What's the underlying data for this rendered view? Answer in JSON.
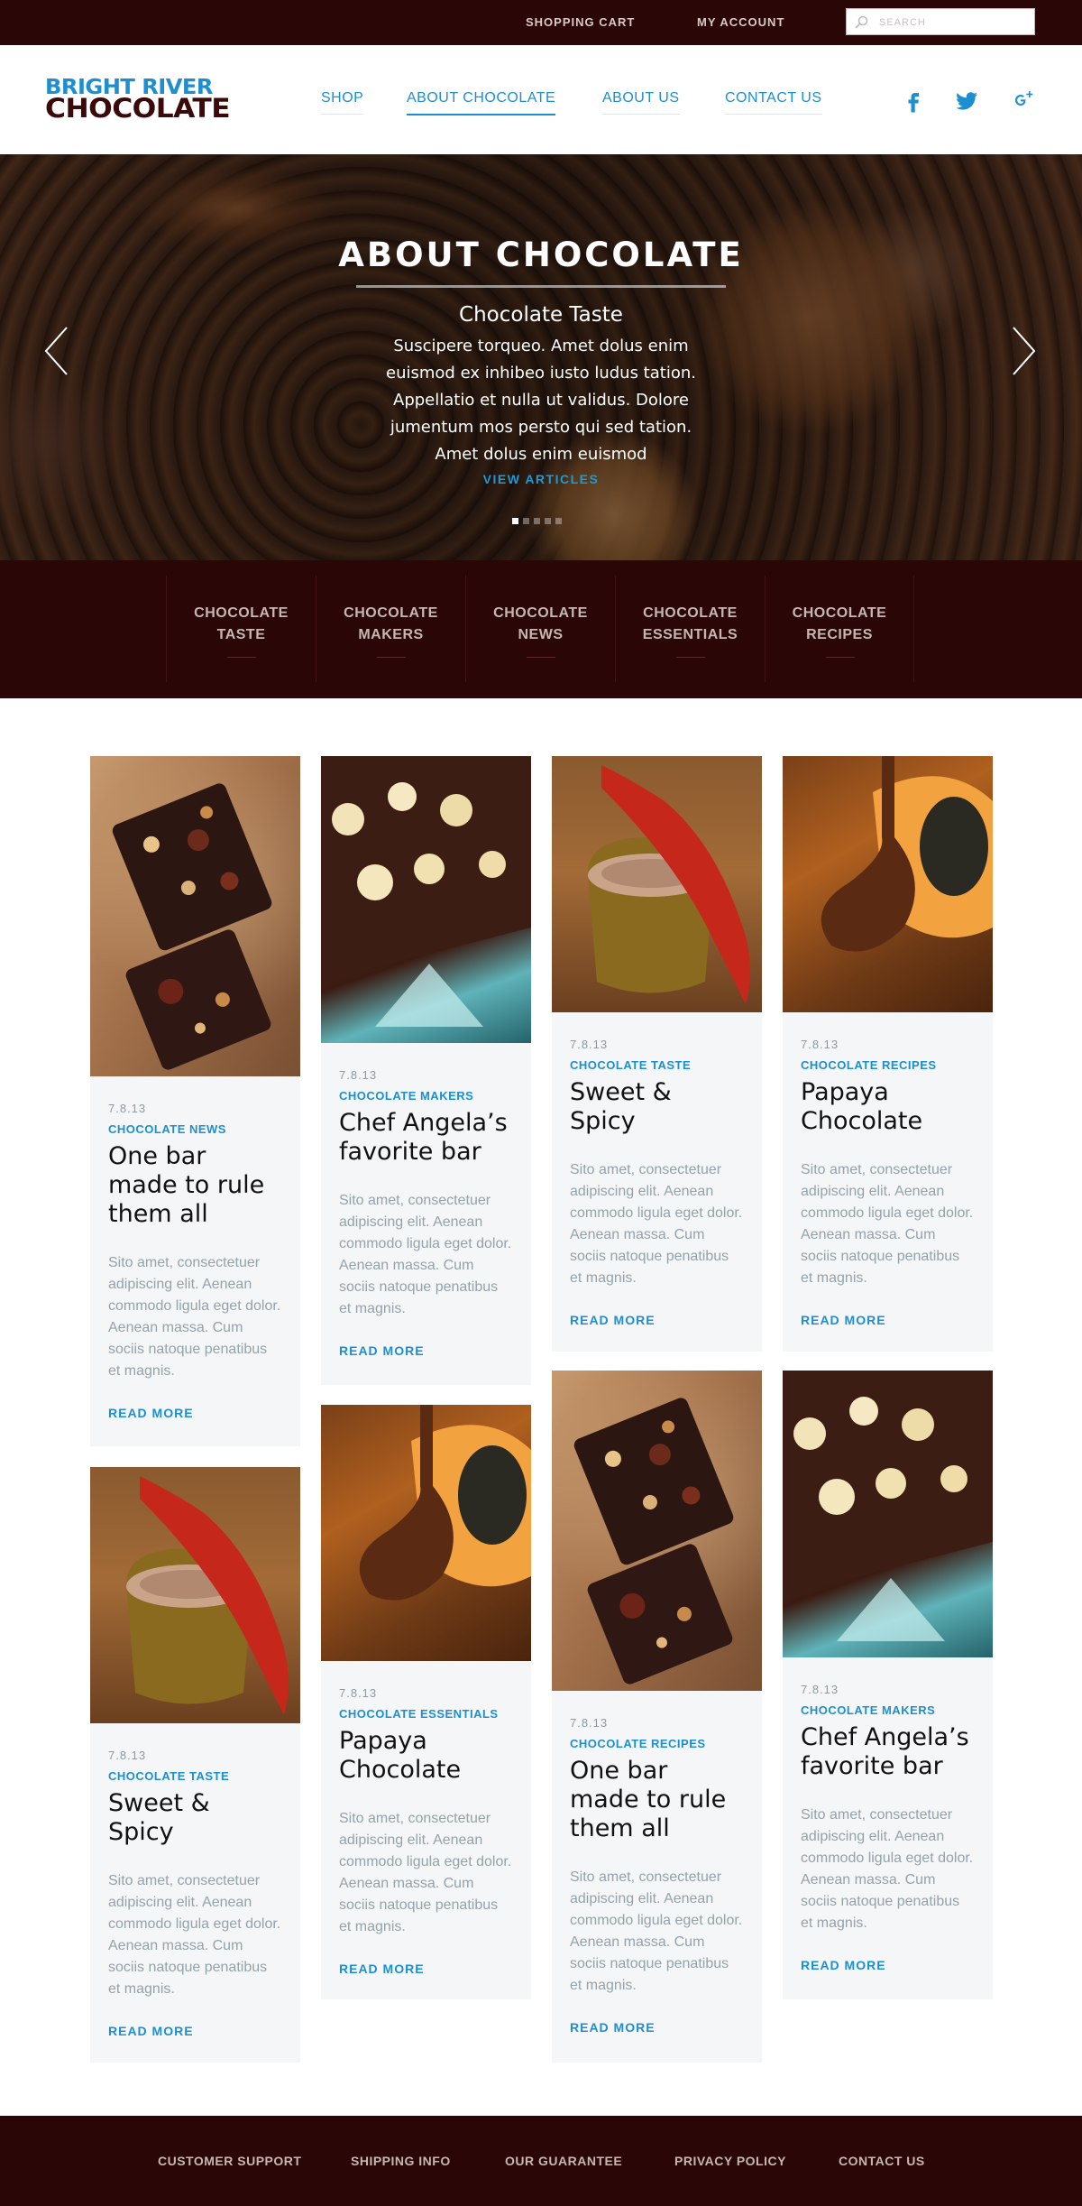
{
  "topbar": {
    "shopping_cart": "SHOPPING CART",
    "my_account": "MY ACCOUNT",
    "search_placeholder": "SEARCH"
  },
  "header": {
    "logo_line1": "BRIGHT RIVER",
    "logo_line2": "CHOCOLATE",
    "nav": [
      "SHOP",
      "ABOUT CHOCOLATE",
      "ABOUT US",
      "CONTACT US"
    ],
    "active_nav": "ABOUT CHOCOLATE",
    "social_icons": [
      "facebook-icon",
      "twitter-icon",
      "google-plus-icon"
    ]
  },
  "hero": {
    "title": "ABOUT CHOCOLATE",
    "subtitle": "Chocolate Taste",
    "body": "Suscipere torqueo. Amet dolus enim euismod ex inhibeo iusto ludus tation. Appellatio et nulla ut validus. Dolore jumentum mos persto qui sed tation. Amet dolus enim euismod",
    "cta": "VIEW ARTICLES",
    "slide_count": 5,
    "active_slide": 1
  },
  "categories": [
    {
      "line1": "CHOCOLATE",
      "line2": "TASTE"
    },
    {
      "line1": "CHOCOLATE",
      "line2": "MAKERS"
    },
    {
      "line1": "CHOCOLATE",
      "line2": "NEWS"
    },
    {
      "line1": "CHOCOLATE",
      "line2": "ESSENTIALS"
    },
    {
      "line1": "CHOCOLATE",
      "line2": "RECIPES"
    }
  ],
  "articles": [
    {
      "image": "chocolate-bars-image",
      "date": "7.8.13",
      "category": "CHOCOLATE NEWS",
      "title": "One bar made to rule them all",
      "excerpt": "Sito amet, consectetuer adipiscing elit. Aenean commodo ligula eget dolor. Aenean massa. Cum sociis natoque penatibus et magnis.",
      "more": "READ MORE"
    },
    {
      "image": "hazelnut-chocolate-image",
      "date": "7.8.13",
      "category": "CHOCOLATE MAKERS",
      "title": "Chef Angela’s favorite bar",
      "excerpt": "Sito amet, consectetuer adipiscing elit. Aenean commodo ligula eget dolor. Aenean massa. Cum sociis natoque penatibus et magnis.",
      "more": "READ MORE"
    },
    {
      "image": "chili-cocoa-image",
      "date": "7.8.13",
      "category": "CHOCOLATE TASTE",
      "title": "Sweet & Spicy",
      "excerpt": "Sito amet, consectetuer adipiscing elit. Aenean commodo ligula eget dolor. Aenean massa. Cum sociis natoque penatibus et magnis.",
      "more": "READ MORE"
    },
    {
      "image": "papaya-chocolate-image",
      "date": "7.8.13",
      "category": "CHOCOLATE RECIPES",
      "title": "Papaya Chocolate",
      "excerpt": "Sito amet, consectetuer adipiscing elit. Aenean commodo ligula eget dolor. Aenean massa. Cum sociis natoque penatibus et magnis.",
      "more": "READ MORE"
    },
    {
      "image": "chili-cocoa-image",
      "date": "7.8.13",
      "category": "CHOCOLATE TASTE",
      "title": "Sweet & Spicy",
      "excerpt": "Sito amet, consectetuer adipiscing elit. Aenean commodo ligula eget dolor. Aenean massa. Cum sociis natoque penatibus et magnis.",
      "more": "READ MORE"
    },
    {
      "image": "papaya-chocolate-image",
      "date": "7.8.13",
      "category": "CHOCOLATE ESSENTIALS",
      "title": "Papaya Chocolate",
      "excerpt": "Sito amet, consectetuer adipiscing elit. Aenean commodo ligula eget dolor. Aenean massa. Cum sociis natoque penatibus et magnis.",
      "more": "READ MORE"
    },
    {
      "image": "chocolate-bars-image",
      "date": "7.8.13",
      "category": "CHOCOLATE RECIPES",
      "title": "One bar made to rule them all",
      "excerpt": "Sito amet, consectetuer adipiscing elit. Aenean commodo ligula eget dolor. Aenean massa. Cum sociis natoque penatibus et magnis.",
      "more": "READ MORE"
    },
    {
      "image": "hazelnut-chocolate-image",
      "date": "7.8.13",
      "category": "CHOCOLATE MAKERS",
      "title": "Chef Angela’s favorite bar",
      "excerpt": "Sito amet, consectetuer adipiscing elit. Aenean commodo ligula eget dolor. Aenean massa. Cum sociis natoque penatibus et magnis.",
      "more": "READ MORE"
    }
  ],
  "footer": [
    "CUSTOMER SUPPORT",
    "SHIPPING INFO",
    "OUR GUARANTEE",
    "PRIVACY POLICY",
    "CONTACT US"
  ],
  "colors": {
    "dark_brown": "#2a0606",
    "accent_blue": "#1d8fd0",
    "card_bg": "#f5f6f8",
    "muted_text": "#94a2aa"
  }
}
